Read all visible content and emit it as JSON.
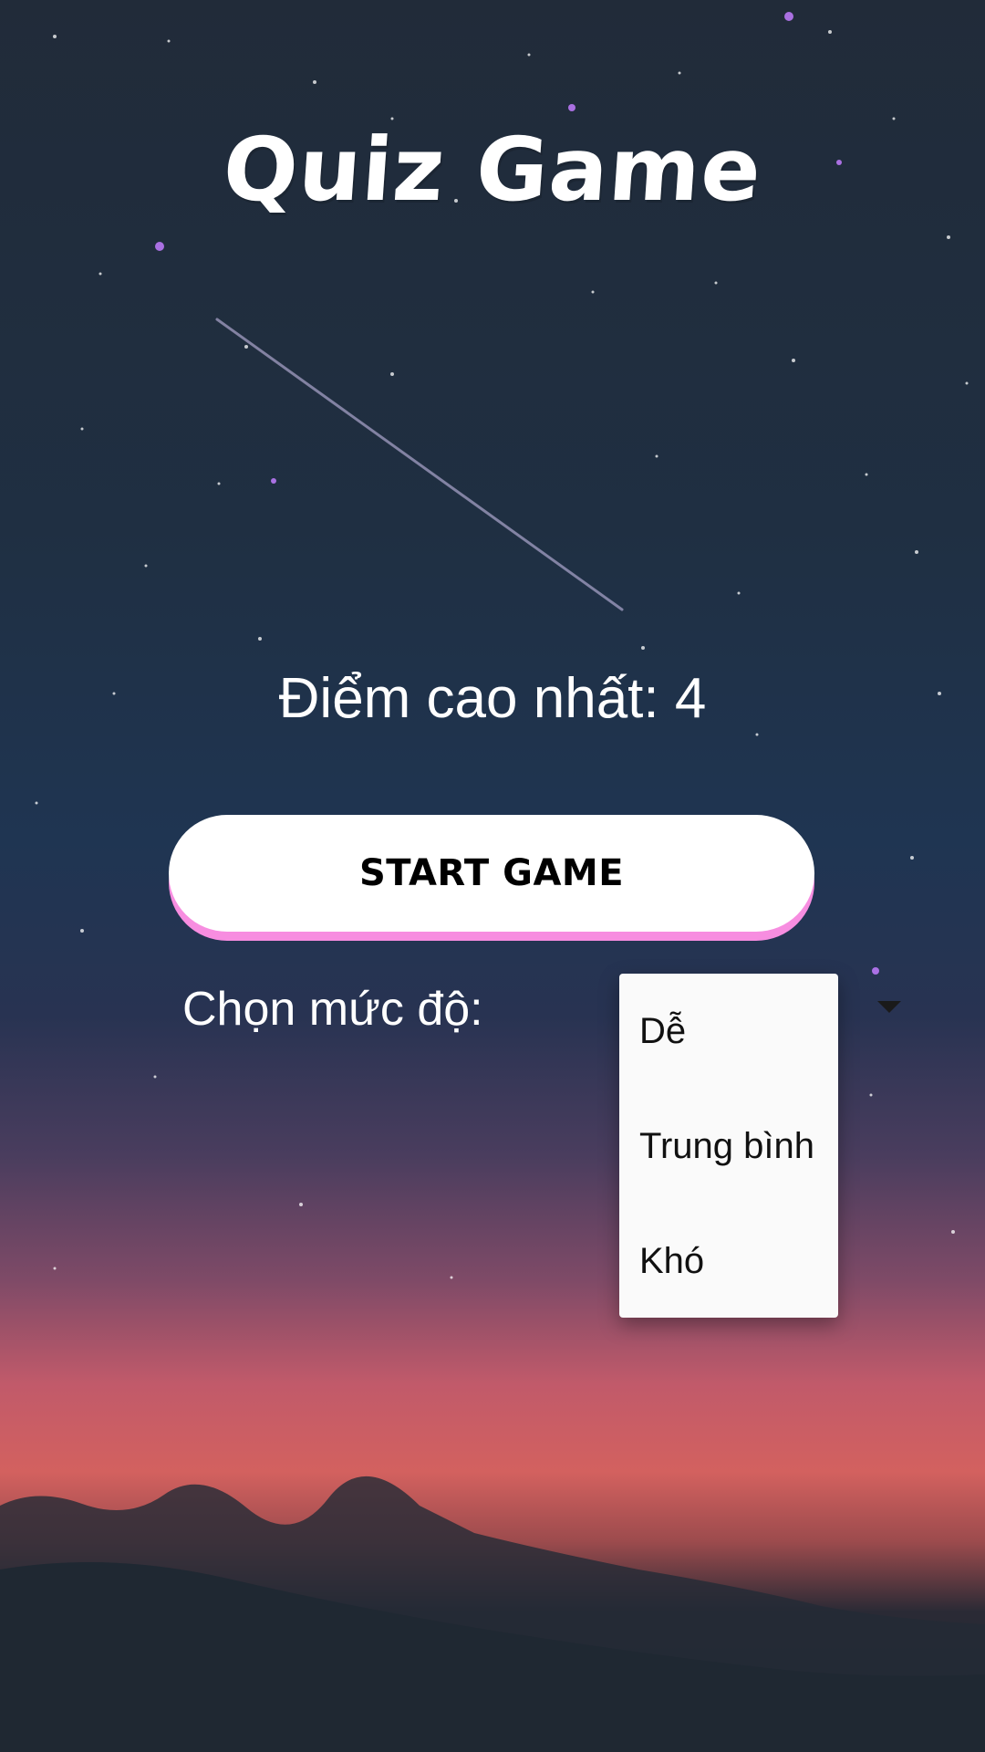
{
  "app": {
    "title": "Quiz Game",
    "high_score_text": "Điểm cao nhất: 4"
  },
  "start_button": {
    "label": "START GAME"
  },
  "level": {
    "label": "Chọn mức độ:",
    "options": [
      "Dễ",
      "Trung bình",
      "Khó"
    ]
  },
  "colors": {
    "button_bg": "#ffffff",
    "button_shadow": "#f78de0",
    "menu_bg": "#fafafa",
    "text_light": "#ffffff",
    "text_dark": "#111111"
  },
  "icons": {
    "spinner": "dropdown-arrow-icon"
  }
}
